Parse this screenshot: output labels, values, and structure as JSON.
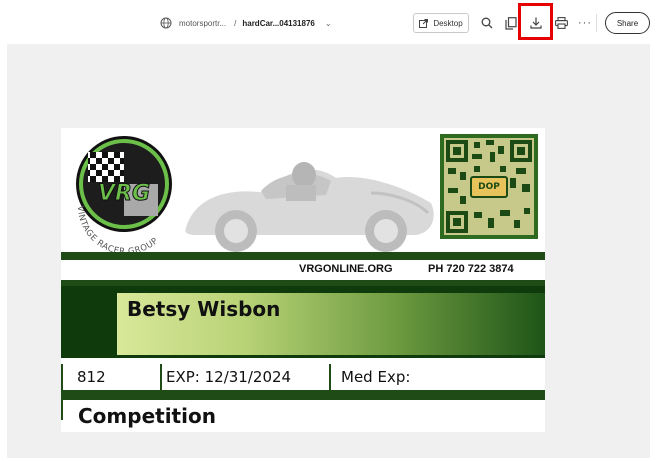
{
  "header": {
    "site": "motorsportr...",
    "separator": "/",
    "filename": "hardCar...04131876",
    "desktop_label": "Desktop",
    "share_label": "Share"
  },
  "card": {
    "website": "VRGONLINE.ORG",
    "phone": "PH 720 722 3874",
    "qr_label": "DOP",
    "name": "Betsy Wisbon",
    "number": "812",
    "expiration": "EXP: 12/31/2024",
    "med_exp": "Med Exp:",
    "category": "Competition",
    "logo_text": "VRG",
    "logo_ring_text": "VINTAGE RACER GROUP"
  },
  "colors": {
    "dark_green": "#1f4b16",
    "highlight_red": "#e60000"
  }
}
